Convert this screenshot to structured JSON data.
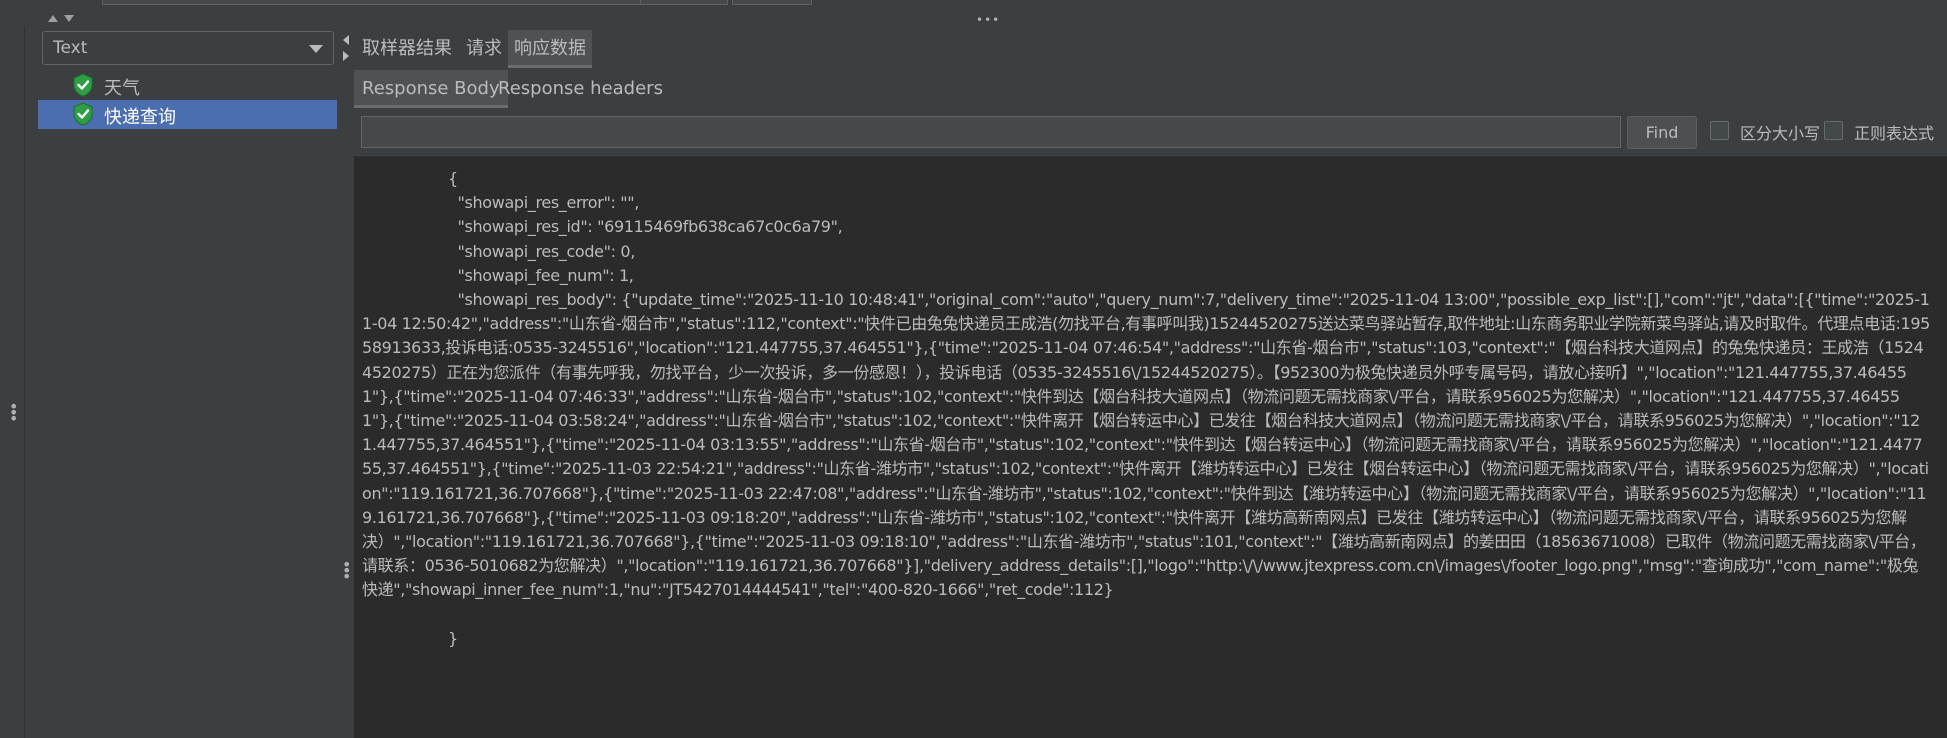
{
  "top": {
    "grip_icon": "grip-horizontal-icon"
  },
  "tree": {
    "view_combo": {
      "selected": "Text"
    },
    "items": [
      {
        "label": "天气",
        "status": "success",
        "selected": false
      },
      {
        "label": "快递查询",
        "status": "success",
        "selected": true
      }
    ]
  },
  "tabs": [
    {
      "label": "取样器结果",
      "active": false
    },
    {
      "label": "请求",
      "active": false
    },
    {
      "label": "响应数据",
      "active": true
    }
  ],
  "subtabs": [
    {
      "label": "Response Body",
      "active": true
    },
    {
      "label": "Response headers",
      "active": false
    }
  ],
  "search": {
    "value": "",
    "find_label": "Find",
    "case_label": "区分大小写",
    "regex_label": "正则表达式"
  },
  "response": {
    "open_brace": "{",
    "lines": [
      "  \"showapi_res_error\": \"\",",
      "  \"showapi_res_id\": \"69115469fb638ca67c0c6a79\",",
      "  \"showapi_res_code\": 0,",
      "  \"showapi_fee_num\": 1,"
    ],
    "body_text": "  \"showapi_res_body\": {\"update_time\":\"2025-11-10 10:48:41\",\"original_com\":\"auto\",\"query_num\":7,\"delivery_time\":\"2025-11-04 13:00\",\"possible_exp_list\":[],\"com\":\"jt\",\"data\":[{\"time\":\"2025-11-04 12:50:42\",\"address\":\"山东省-烟台市\",\"status\":112,\"context\":\"快件已由兔兔快递员王成浩(勿找平台,有事呼叫我)15244520275送达菜鸟驿站暂存,取件地址:山东商务职业学院新菜鸟驿站,请及时取件。代理点电话:19558913633,投诉电话:0535-3245516\",\"location\":\"121.447755,37.464551\"},{\"time\":\"2025-11-04 07:46:54\",\"address\":\"山东省-烟台市\",\"status\":103,\"context\":\"【烟台科技大道网点】的兔兔快递员：王成浩（15244520275）正在为您派件（有事先呼我，勿找平台，少一次投诉，多一份感恩！），投诉电话（0535-3245516\\/15244520275）。【952300为极兔快递员外呼专属号码，请放心接听】\",\"location\":\"121.447755,37.464551\"},{\"time\":\"2025-11-04 07:46:33\",\"address\":\"山东省-烟台市\",\"status\":102,\"context\":\"快件到达【烟台科技大道网点】（物流问题无需找商家\\/平台，请联系956025为您解决）\",\"location\":\"121.447755,37.464551\"},{\"time\":\"2025-11-04 03:58:24\",\"address\":\"山东省-烟台市\",\"status\":102,\"context\":\"快件离开【烟台转运中心】已发往【烟台科技大道网点】（物流问题无需找商家\\/平台，请联系956025为您解决）\",\"location\":\"121.447755,37.464551\"},{\"time\":\"2025-11-04 03:13:55\",\"address\":\"山东省-烟台市\",\"status\":102,\"context\":\"快件到达【烟台转运中心】（物流问题无需找商家\\/平台，请联系956025为您解决）\",\"location\":\"121.447755,37.464551\"},{\"time\":\"2025-11-03 22:54:21\",\"address\":\"山东省-潍坊市\",\"status\":102,\"context\":\"快件离开【潍坊转运中心】已发往【烟台转运中心】（物流问题无需找商家\\/平台，请联系956025为您解决）\",\"location\":\"119.161721,36.707668\"},{\"time\":\"2025-11-03 22:47:08\",\"address\":\"山东省-潍坊市\",\"status\":102,\"context\":\"快件到达【潍坊转运中心】（物流问题无需找商家\\/平台，请联系956025为您解决）\",\"location\":\"119.161721,36.707668\"},{\"time\":\"2025-11-03 09:18:20\",\"address\":\"山东省-潍坊市\",\"status\":102,\"context\":\"快件离开【潍坊高新南网点】已发往【潍坊转运中心】（物流问题无需找商家\\/平台，请联系956025为您解决）\",\"location\":\"119.161721,36.707668\"},{\"time\":\"2025-11-03 09:18:10\",\"address\":\"山东省-潍坊市\",\"status\":101,\"context\":\"【潍坊高新南网点】的姜田田（18563671008）已取件（物流问题无需找商家\\/平台，请联系：0536-5010682为您解决）\",\"location\":\"119.161721,36.707668\"}],\"delivery_address_details\":[],\"logo\":\"http:\\/\\/www.jtexpress.com.cn\\/images\\/footer_logo.png\",\"msg\":\"查询成功\",\"com_name\":\"极兔快递\",\"showapi_inner_fee_num\":1,\"nu\":\"JT5427014444541\",\"tel\":\"400-820-1666\",\"ret_code\":112}",
    "close_brace": "}"
  }
}
